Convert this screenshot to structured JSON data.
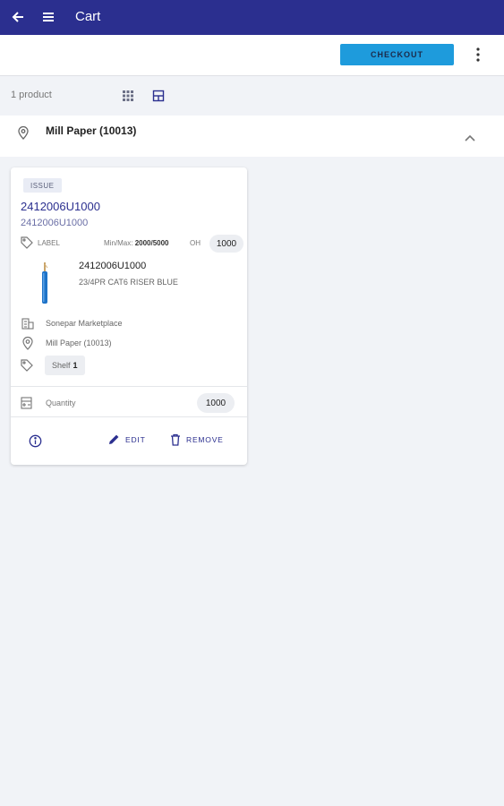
{
  "appbar": {
    "title": "Cart"
  },
  "toolbar": {
    "checkout_label": "CHECKOUT"
  },
  "summary": {
    "count_text": "1 product"
  },
  "location": {
    "name": "Mill Paper (10013)"
  },
  "item": {
    "badge": "ISSUE",
    "name": "2412006U1000",
    "sub": "2412006U1000",
    "label_text": "LABEL",
    "minmax_label": "Min/Max:",
    "minmax_value": "2000/5000",
    "oh_label": "OH",
    "oh_value": "1000",
    "product_title": "2412006U1000",
    "product_desc": "23/4PR CAT6 RISER BLUE",
    "supplier": "Sonepar Marketplace",
    "location": "Mill Paper (10013)",
    "shelf_label": "Shelf",
    "shelf_value": "1",
    "quantity_label": "Quantity",
    "quantity_value": "1000",
    "edit_label": "EDIT",
    "remove_label": "REMOVE"
  },
  "colors": {
    "appbar": "#2b2f8f",
    "accent": "#1e9bdc",
    "background": "#f1f3f7"
  }
}
